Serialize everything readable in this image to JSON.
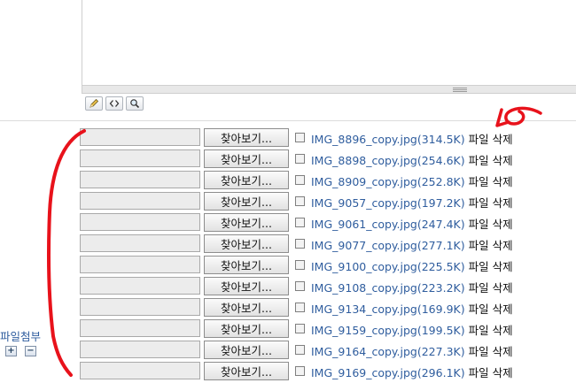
{
  "toolbar": {
    "icons": [
      "pencil-icon",
      "code-icon",
      "search-icon"
    ]
  },
  "attachments": {
    "label": "파일첨부",
    "add": "+",
    "remove": "−",
    "browse_label": "찾아보기...",
    "delete_label": "파일 삭제",
    "files": [
      {
        "name": "IMG_8896_copy.jpg(314.5K)"
      },
      {
        "name": "IMG_8898_copy.jpg(254.6K)"
      },
      {
        "name": "IMG_8909_copy.jpg(252.8K)"
      },
      {
        "name": "IMG_9057_copy.jpg(197.2K)"
      },
      {
        "name": "IMG_9061_copy.jpg(247.4K)"
      },
      {
        "name": "IMG_9077_copy.jpg(277.1K)"
      },
      {
        "name": "IMG_9100_copy.jpg(225.5K)"
      },
      {
        "name": "IMG_9108_copy.jpg(223.2K)"
      },
      {
        "name": "IMG_9134_copy.jpg(169.9K)"
      },
      {
        "name": "IMG_9159_copy.jpg(199.5K)"
      },
      {
        "name": "IMG_9164_copy.jpg(227.3K)"
      },
      {
        "name": "IMG_9169_copy.jpg(296.1K)"
      }
    ]
  },
  "colors": {
    "link": "#2f5d9e",
    "annotation": "#e8121b"
  }
}
